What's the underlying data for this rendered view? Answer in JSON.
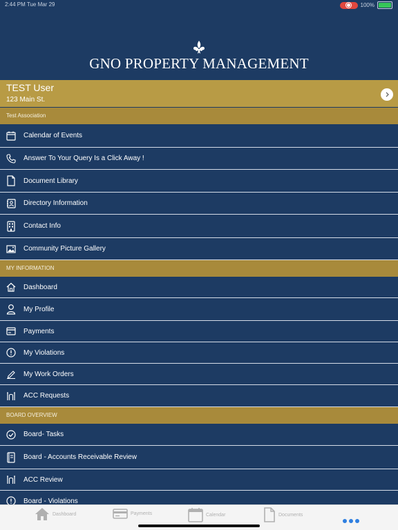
{
  "status_bar": {
    "time": "2:44 PM  Tue Mar 29",
    "battery": "100%"
  },
  "brand": {
    "name": "GNO PROPERTY MANAGEMENT"
  },
  "user": {
    "name": "TEST User",
    "address": "123 Main St."
  },
  "sections": {
    "association": "Test Association",
    "my_information": "MY INFORMATION",
    "board_overview": "BOARD OVERVIEW"
  },
  "association_items": [
    {
      "label": "Calendar of Events",
      "icon": "calendar-icon"
    },
    {
      "label": "Answer To Your Query Is a Click Away !",
      "icon": "phone-icon"
    },
    {
      "label": "Document Library",
      "icon": "document-icon"
    },
    {
      "label": "Directory Information",
      "icon": "contact-card-icon"
    },
    {
      "label": "Contact Info",
      "icon": "building-icon"
    },
    {
      "label": "Community Picture Gallery",
      "icon": "image-icon"
    }
  ],
  "my_information_items": [
    {
      "label": "Dashboard",
      "icon": "home-icon"
    },
    {
      "label": "My Profile",
      "icon": "person-icon"
    },
    {
      "label": "Payments",
      "icon": "credit-card-icon"
    },
    {
      "label": "My Violations",
      "icon": "alert-circle-icon"
    },
    {
      "label": "My Work Orders",
      "icon": "pen-icon"
    },
    {
      "label": "ACC Requests",
      "icon": "arch-icon"
    }
  ],
  "board_items": [
    {
      "label": "Board- Tasks",
      "icon": "check-circle-icon"
    },
    {
      "label": "Board - Accounts Receivable Review",
      "icon": "ledger-icon"
    },
    {
      "label": "ACC Review",
      "icon": "arch-icon"
    },
    {
      "label": "Board - Violations",
      "icon": "alert-circle-icon"
    }
  ],
  "tab_bar": {
    "dashboard": "Dashboard",
    "payments": "Payments",
    "calendar": "Calendar",
    "documents": "Documents"
  },
  "colors": {
    "background": "#1d3b63",
    "accent": "#b89b45",
    "section": "#a88a3b",
    "tab_active": "#2f7fe0"
  }
}
